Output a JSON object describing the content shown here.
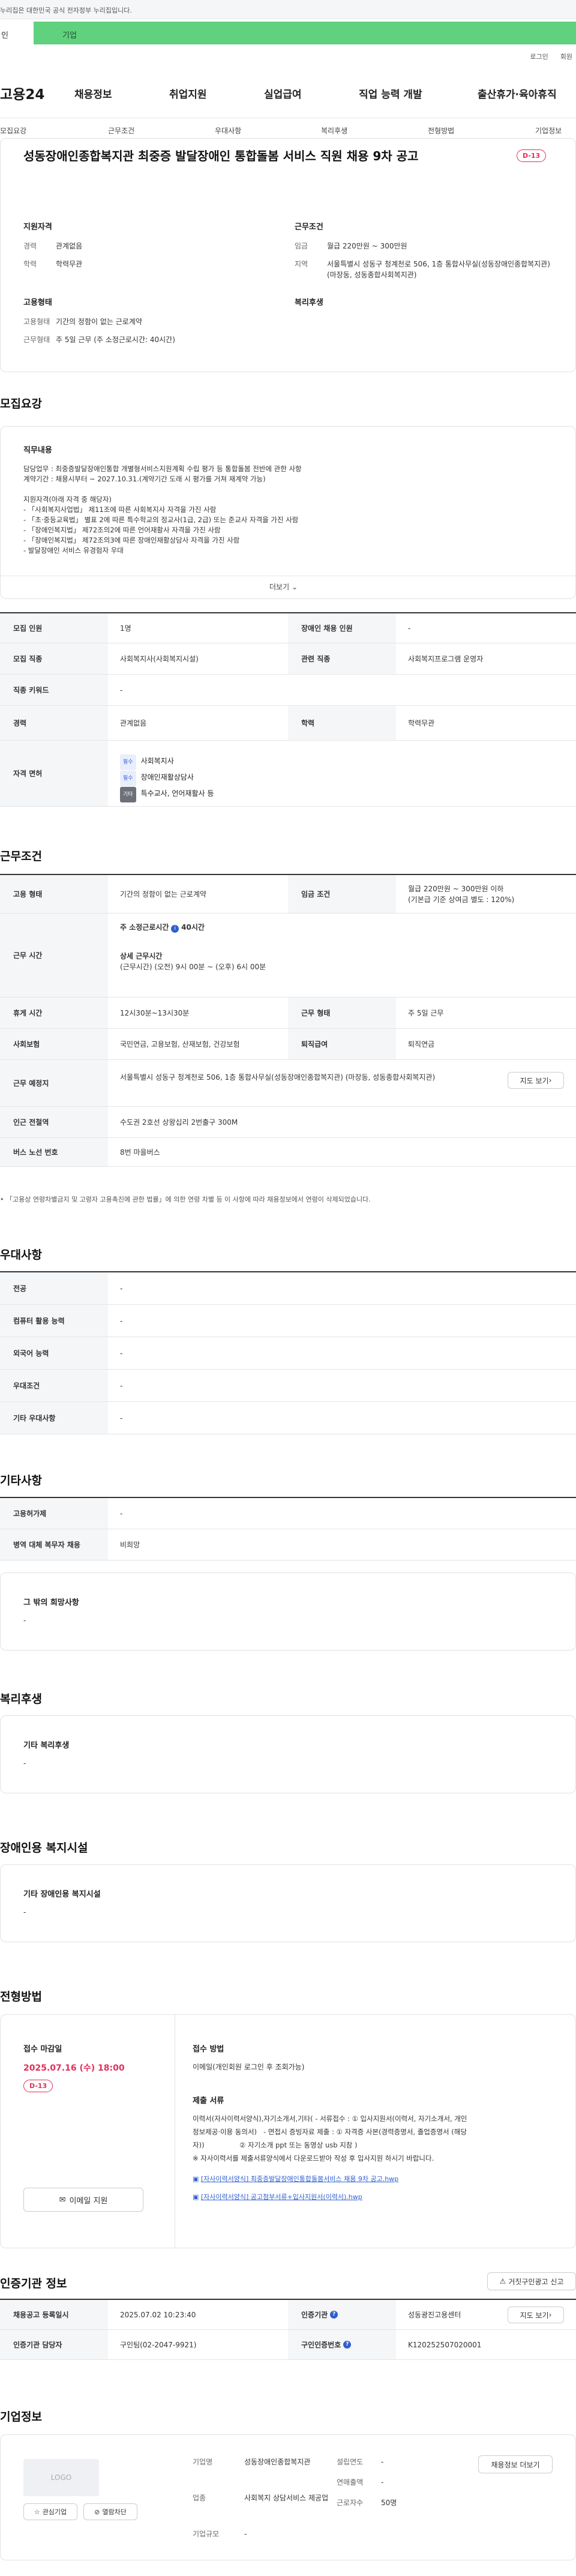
{
  "gov_banner": {
    "text": "누리집은 대한민국 공식 전자정부 누리집입니다."
  },
  "user_tabs": {
    "personal": "인",
    "company": "기업"
  },
  "top_links": [
    "로그인",
    "회원"
  ],
  "logo": "고용24",
  "gnb": [
    "채용정보",
    "취업지원",
    "실업급여",
    "직업 능력 개발",
    "출산휴가·육아휴직"
  ],
  "subnav": [
    "모집요강",
    "근무조건",
    "우대사항",
    "복리후생",
    "전형방법",
    "기업정보"
  ],
  "summary": {
    "title": "성동장애인종합복지관 최중증 발달장애인 통합돌봄 서비스 직원 채용 9차 공고",
    "dday": "D-13",
    "qual_title": "지원자격",
    "qual": [
      {
        "k": "경력",
        "v": "관계없음"
      },
      {
        "k": "학력",
        "v": "학력무관"
      }
    ],
    "cond_title": "근무조건",
    "cond": [
      {
        "k": "임금",
        "v": "월급 220만원 ~ 300만원"
      },
      {
        "k": "지역",
        "v": "서울특별시 성동구 청계천로 506, 1층 통합사무실(성동장애인종합복지관) (마장동, 성동종합사회복지관)"
      }
    ],
    "emp_title": "고용형태",
    "emp": [
      {
        "k": "고용형태",
        "v": "기간의 정함이 없는 근로계약"
      },
      {
        "k": "근무형태",
        "v": "주 5일 근무 (주 소정근로시간: 40시간)"
      }
    ],
    "welfare_title": "복리후생"
  },
  "recruit": {
    "section_title": "모집요강",
    "duty_title": "직무내용",
    "duty_lines": [
      "담당업무 : 최중증발달장애인통합 개별형서비스지원계획 수립 평가 등 통합돌봄 전반에 관한 사항",
      "계약기간 : 채용시부터 ~ 2027.10.31.(계약기간 도래 시 평가를 거쳐 재계약 가능)",
      "",
      "지원자격(아래 자격 중 해당자)",
      "- 「사회복지사업법」 제11조에 따른 사회복지사 자격을 가진 사람",
      "- 「초·중등교육법」 별표 2에 따른 특수학교의 정교사(1급, 2급) 또는 준교사 자격을 가진 사람",
      "- 「장애인복지법」 제72조의2에 따른 언어재활사 자격을 가진 사람",
      "- 「장애인복지법」 제72조의3에 따른 장애인재활상담사 자격을 가진 사람",
      "- 발달장애인 서비스 유경험자 우대"
    ],
    "more": "더보기",
    "rows": [
      {
        "h1": "모집 인원",
        "v1": "1명",
        "h2": "장애인 채용 인원",
        "v2": "-"
      },
      {
        "h1": "모집 직종",
        "v1": "사회복지사(사회복지시설)",
        "h2": "관련 직종",
        "v2": "사회복지프로그램 운영자"
      },
      {
        "h1": "직종 키워드",
        "v1": "-"
      },
      {
        "h1": "경력",
        "v1": "관계없음",
        "h2": "학력",
        "v2": "학력무관"
      }
    ],
    "license_label": "자격 면허",
    "licenses": [
      {
        "tag": "필수",
        "name": "사회복지사"
      },
      {
        "tag": "필수",
        "name": "장애인재활상담사"
      },
      {
        "tag": "기타",
        "name": "특수교사, 언어재활사 등"
      }
    ]
  },
  "work": {
    "section_title": "근무조건",
    "emp_h": "고용 형태",
    "emp_v": "기간의 정함이 없는 근로계약",
    "wage_h": "임금 조건",
    "wage_v1": "월급 220만원 ~ 300만원 이하",
    "wage_v2": "(기본급 기준 상여금 별도 : 120%)",
    "time_h": "근무 시간",
    "time_week": "주 소정근로시간",
    "time_week_val": "40시간",
    "time_detail_title": "상세 근무시간",
    "time_detail": "(근무시간) (오전) 9시 00분 ~ (오후) 6시 00분",
    "break_h": "휴게 시간",
    "break_v": "12시30분~13시30분",
    "form_h": "근무 형태",
    "form_v": "주 5일 근무",
    "ins_h": "사회보험",
    "ins_v": "국민연금, 고용보험, 산재보험, 건강보험",
    "sev_h": "퇴직급여",
    "sev_v": "퇴직연금",
    "place_h": "근무 예정지",
    "place_v": "서울특별시 성동구 청계천로 506, 1층 통합사무실(성동장애인종합복지관) (마장동, 성동종합사회복지관)",
    "map_btn": "지도 보기",
    "subway_h": "인근 전철역",
    "subway_v": "수도권 2호선 상왕십리 2번출구 300M",
    "bus_h": "버스 노선 번호",
    "bus_v": "8번 마을버스",
    "footnote": "「고용상 연령차별금지 및 고령자 고용촉진에 관한 법률」에 의한 연령 차별 등 이 사항에 따라 채용정보에서 연령이 삭제되었습니다."
  },
  "prefer": {
    "section_title": "우대사항",
    "rows": [
      {
        "h": "전공",
        "v": "-"
      },
      {
        "h": "컴퓨터 활용 능력",
        "v": "-"
      },
      {
        "h": "외국어 능력",
        "v": "-"
      },
      {
        "h": "우대조건",
        "v": "-"
      },
      {
        "h": "기타 우대사항",
        "v": "-"
      }
    ]
  },
  "etc": {
    "section_title": "기타사항",
    "rows": [
      {
        "h": "고용허가제",
        "v": "-"
      },
      {
        "h": "병역 대체 복무자 채용",
        "v": "비희망"
      }
    ],
    "wish_title": "그 밖의 희망사항",
    "wish_val": "-"
  },
  "welfare": {
    "section_title": "복리후생",
    "box_title": "기타 복리후생",
    "box_val": "-"
  },
  "disabled": {
    "section_title": "장애인용 복지시설",
    "box_title": "기타 장애인용 복지시설",
    "box_val": "-"
  },
  "process": {
    "section_title": "전형방법",
    "deadline_label": "접수 마감일",
    "deadline": "2025.07.16 (수) 18:00",
    "dday": "D-13",
    "apply_btn": "이메일 지원",
    "method_label": "접수 방법",
    "method": "이메일(개인회원 로그인 후 조회가능)",
    "docs_label": "제출 서류",
    "docs_lines": [
      "이력서(자사이력서양식),자기소개서,기타( - 서류접수 : ① 입사지원서(이력서, 자기소개서, 개인",
      "정보제공·이용 동의서)   - 면접시 증빙자료 제출 : ① 자격증 사본(경력증명서, 졸업증명서 (해당",
      "자))                ② 자기소개 ppt 또는 동영상 usb 지참 )",
      "※ 자사이력서를 제출서류양식에서 다운로드받아 작성 후 입사지원 하시기 바랍니다."
    ],
    "files": [
      "[자사이력서양식] 최중증발달장애인통합돌봄서비스 채용 9차 공고.hwp",
      "[자사이력서양식] 공고첨부서류+입사지원서(이력서).hwp"
    ]
  },
  "cert": {
    "section_title": "인증기관 정보",
    "btn": "거짓구인광고 신고",
    "rows": [
      {
        "h1": "채용공고 등록일시",
        "v1": "2025.07.02 10:23:40",
        "h2": "인증기관",
        "v2": "성동광진고용센터",
        "btn": "지도 보기"
      },
      {
        "h1": "인증기관 담당자",
        "v1": "구인팀(02-2047-9921)",
        "h2": "구인인증번호",
        "v2": "K120252507020001"
      }
    ]
  },
  "company": {
    "section_title": "기업정보",
    "logo_text": "LOGO",
    "fav_btn": "관심기업",
    "block_btn": "열람차단",
    "f1": [
      {
        "k": "기업명",
        "v": "성동장애인종합복지관"
      },
      {
        "k": "업종",
        "v": "사회복지 상담서비스 제공업"
      },
      {
        "k": "기업규모",
        "v": "-"
      }
    ],
    "f2": [
      {
        "k": "설립연도",
        "v": "-"
      },
      {
        "k": "연매출액",
        "v": "-"
      },
      {
        "k": "근로자수",
        "v": "50명"
      }
    ],
    "more_btn": "채용정보 더보기"
  }
}
